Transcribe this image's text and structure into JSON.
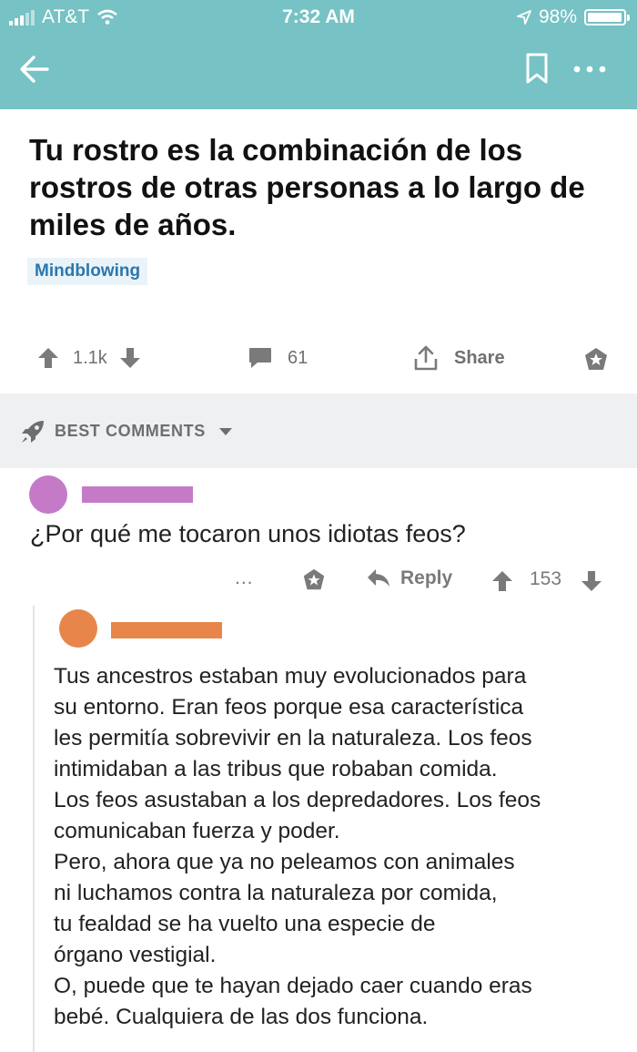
{
  "status_bar": {
    "carrier": "AT&T",
    "time": "7:32 AM",
    "battery": "98%",
    "battery_level": 0.98
  },
  "nav": {
    "back_icon": "back-arrow-icon",
    "bookmark_icon": "bookmark-icon",
    "more_icon": "more-icon"
  },
  "post": {
    "title": "Tu rostro es la combinación de los rostros de otras personas a lo largo de miles de años.",
    "flair": "Mindblowing",
    "upvotes": "1.1k",
    "comments": "61",
    "share": "Share"
  },
  "comments_header": {
    "label": "BEST COMMENTS"
  },
  "comments": [
    {
      "avatar_color": "#c57ac8",
      "body": "¿Por qué me tocaron unos idiotas feos?",
      "more": "...",
      "reply": "Reply",
      "score": "153",
      "replies": [
        {
          "avatar_color": "#e8854a",
          "lines": [
            "Tus ancestros estaban muy evolucionados para",
            "su entorno. Eran feos porque esa característica",
            "les permitía sobrevivir en la naturaleza. Los feos",
            "intimidaban a las tribus que robaban comida.",
            "Los feos asustaban a los depredadores. Los feos",
            "comunicaban fuerza y poder.",
            "Pero, ahora que ya no peleamos con animales",
            "ni luchamos contra la naturaleza por comida,",
            "tu fealdad se ha vuelto una especie de",
            "órgano vestigial.",
            "O, puede que te hayan dejado caer cuando eras",
            "bebé. Cualquiera de las dos funciona."
          ]
        }
      ]
    }
  ],
  "colors": {
    "header": "#76c2c5",
    "flair_text": "#2a78ae",
    "section_bg": "#eef0f1"
  }
}
